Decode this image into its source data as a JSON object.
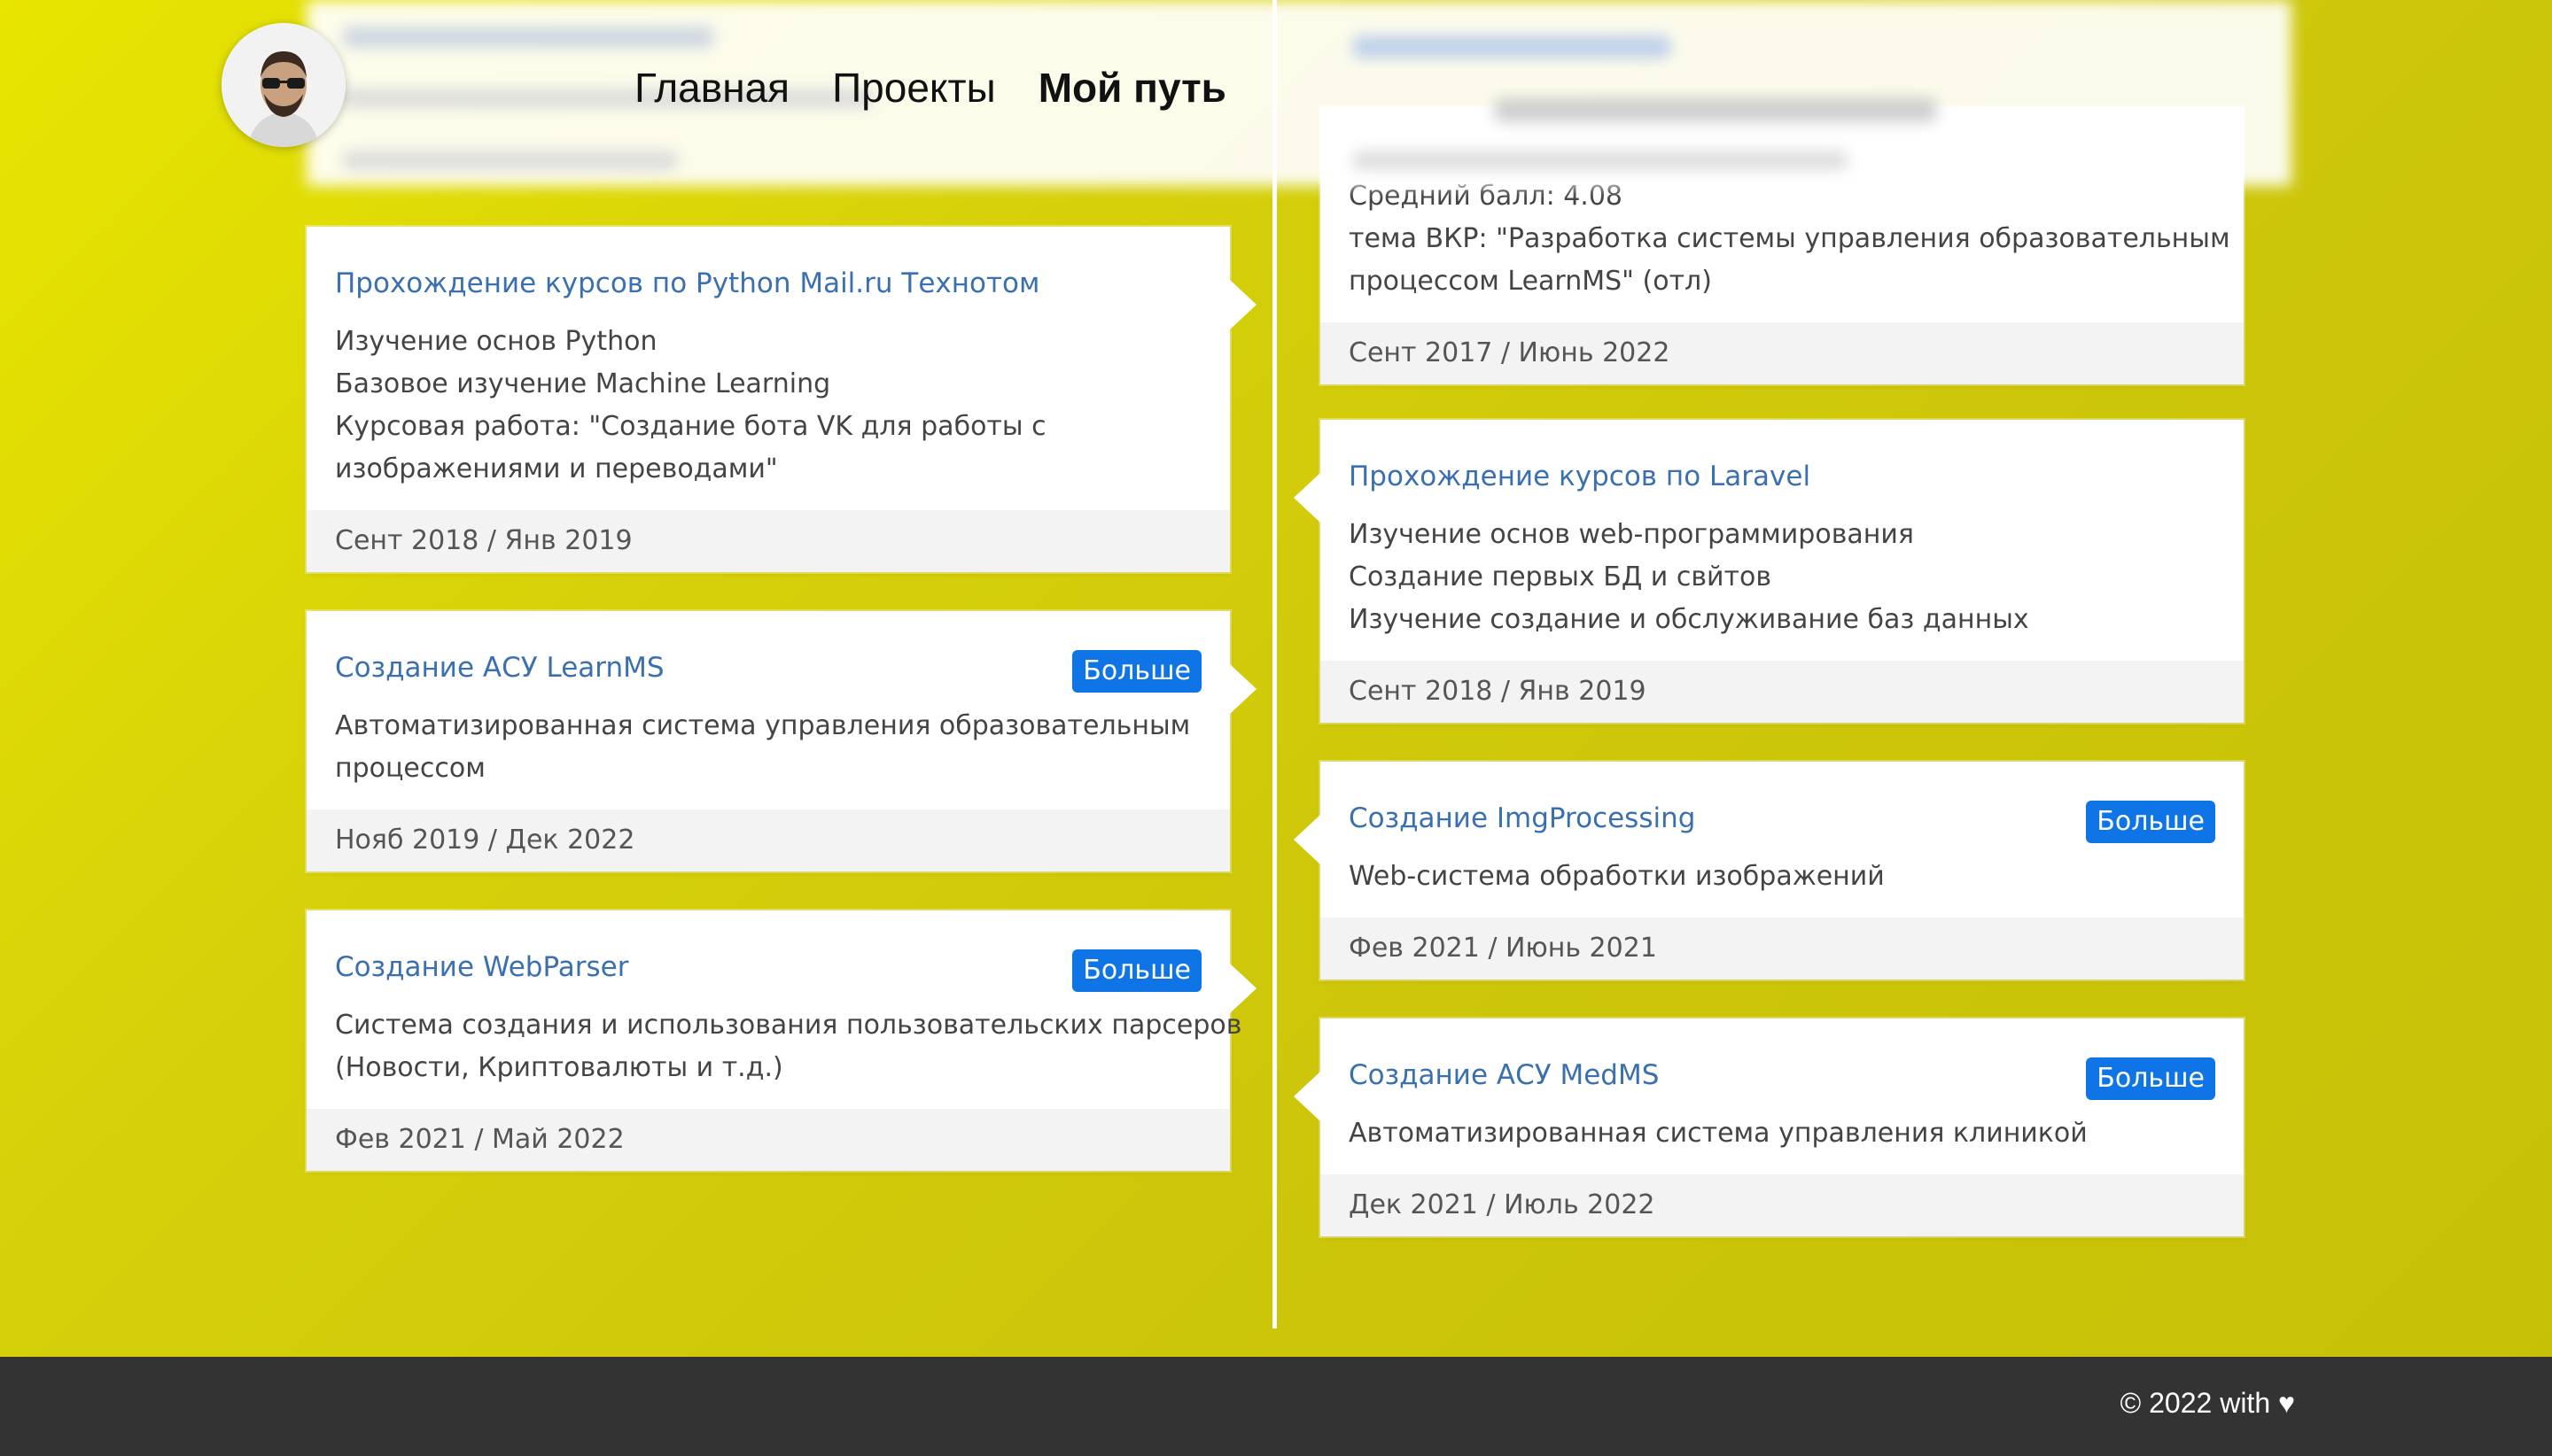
{
  "nav": {
    "items": [
      {
        "label": "Главная",
        "active": false
      },
      {
        "label": "Проекты",
        "active": false
      },
      {
        "label": "Мой путь",
        "active": true
      }
    ]
  },
  "timeline": {
    "left": [
      {
        "title": "Прохождение курсов по Python Mail.ru Технотом",
        "lines": [
          "Изучение основ Python",
          "Базовое изучение Machine Learning",
          "Курсовая работа: \"Создание бота VK для работы с",
          "изображениями и переводами\""
        ],
        "dates": "Сент 2018 / Янв 2019"
      },
      {
        "title": "Создание АСУ LearnMS",
        "button": "Больше",
        "lines": [
          "Автоматизированная система управления образовательным",
          "процессом"
        ],
        "dates": "Нояб 2019 / Дек 2022"
      },
      {
        "title": "Создание WebParser",
        "button": "Больше",
        "lines": [
          "Система создания и использования пользовательских парсеров",
          "(Новости, Криптовалюты и т.д.)"
        ],
        "dates": "Фев 2021 / Май 2022"
      }
    ],
    "right": [
      {
        "lines": [
          "Средний балл: 4.08",
          "тема ВКР: \"Разработка системы управления образовательным",
          "процессом LearnMS\" (отл)"
        ],
        "dates": "Сент 2017 / Июнь 2022"
      },
      {
        "title": "Прохождение курсов по Laravel",
        "lines": [
          "Изучение основ web-программирования",
          "Создание первых БД и свйтов",
          "Изучение создание и обслуживание баз данных"
        ],
        "dates": "Сент 2018 / Янв 2019"
      },
      {
        "title": "Создание ImgProcessing",
        "button": "Больше",
        "lines": [
          "Web-система обработки изображений"
        ],
        "dates": "Фев 2021 / Июнь 2021"
      },
      {
        "title": "Создание АСУ MedMS",
        "button": "Больше",
        "lines": [
          "Автоматизированная система управления клиникой"
        ],
        "dates": "Дек 2021 / Июль 2022"
      }
    ]
  },
  "footer": {
    "text": "© 2022 with ♥"
  },
  "colors": {
    "accent": "#0f75e6",
    "title": "#3a6fb0",
    "background": "#d6d10a",
    "footer": "#333333"
  }
}
